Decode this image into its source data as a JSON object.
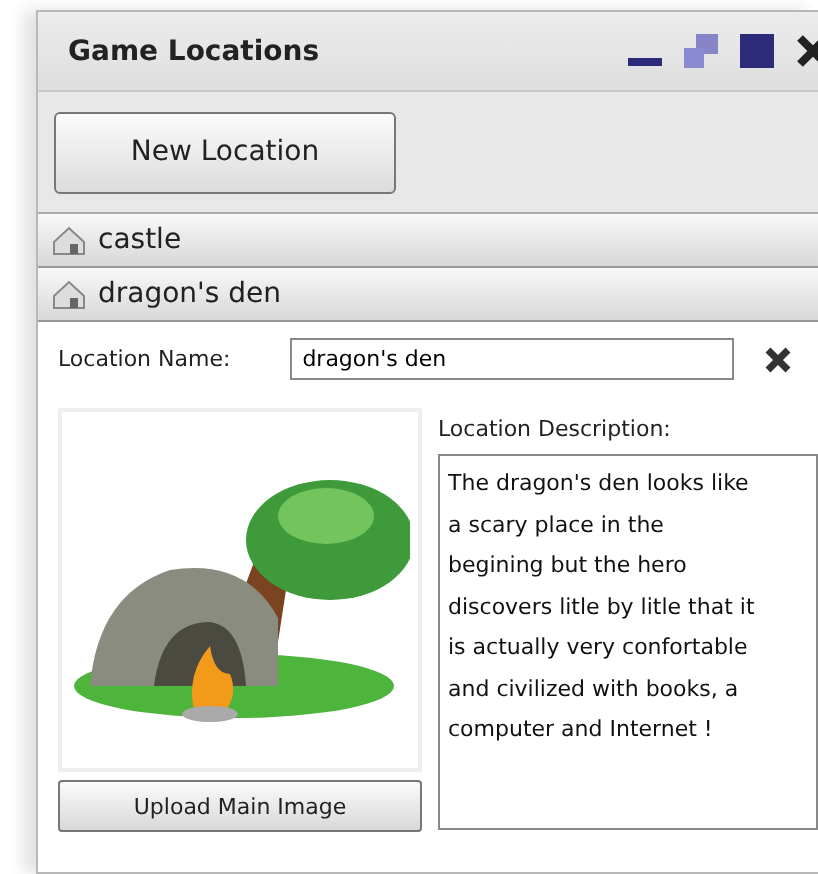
{
  "window": {
    "title": "Game Locations"
  },
  "toolbar": {
    "new_button": "New Location"
  },
  "locations": [
    {
      "name": "castle"
    },
    {
      "name": "dragon's den",
      "form": {
        "name_label": "Location Name:",
        "name_value": "dragon's den",
        "description_label": "Location Description:",
        "description_lines": [
          "The dragon's den looks like",
          "a scary place in the",
          "begining but the hero",
          "discovers litle by litle that it",
          "is actually very confortable",
          "and civilized with books, a",
          "computer and Internet !"
        ],
        "upload_button": "Upload Main Image"
      }
    }
  ]
}
